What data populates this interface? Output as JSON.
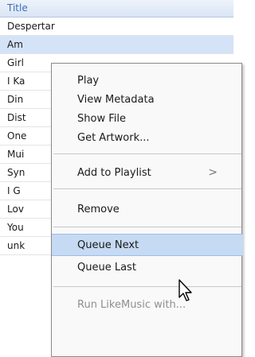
{
  "list": {
    "header": "Title",
    "rows": [
      "Despertar",
      "Am",
      "Girl",
      "I Ka",
      "Din",
      "Dist",
      "One",
      "Mui",
      "Syn",
      "I G",
      "Lov",
      "You",
      "unk"
    ]
  },
  "context_menu": {
    "play": "Play",
    "view_metadata": "View Metadata",
    "show_file": "Show File",
    "get_artwork": "Get Artwork...",
    "add_to_playlist": "Add to Playlist",
    "submenu_arrow": ">",
    "remove": "Remove",
    "queue_next": "Queue Next",
    "queue_last": "Queue Last",
    "run_likemusic": "Run LikeMusic with..."
  },
  "colors": {
    "header_text": "#3b6fb3",
    "selected_row": "#d4e3f7",
    "hover_item": "#c6daf3"
  },
  "icons": {
    "pointer": "arrow-cursor-icon",
    "submenu": "chevron-right-icon"
  }
}
